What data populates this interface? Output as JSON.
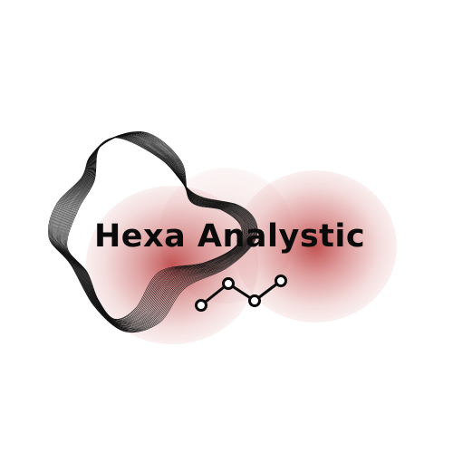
{
  "logo": {
    "brand_name": "Hexa Analystic",
    "colors": {
      "background": "#ffffff",
      "accent_red": "#b42828",
      "text": "#0a0a0a",
      "line_art": "#111111"
    },
    "icons": {
      "wave_lines": "topographic-wave-lines-icon",
      "line_chart": "line-chart-icon"
    }
  }
}
